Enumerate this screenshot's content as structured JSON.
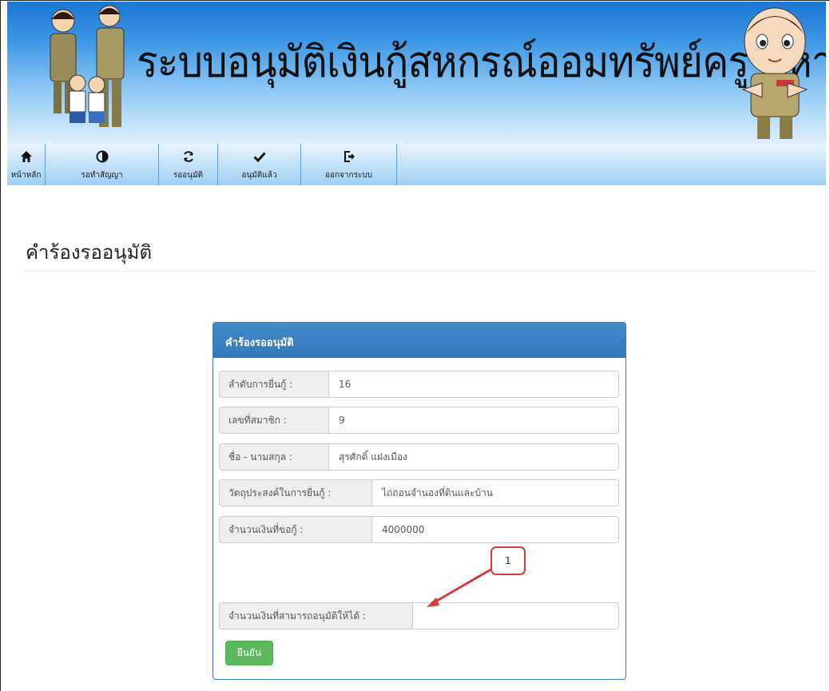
{
  "banner": {
    "title": "ระบบอนุมัติเงินกู้สหกรณ์ออมทรัพย์ครู มหาสารคาม"
  },
  "nav": {
    "items": [
      {
        "label": "หน้าหลัก",
        "icon": "home-icon"
      },
      {
        "label": "รอทำสัญญา",
        "icon": "half-circle-icon"
      },
      {
        "label": "รออนุมัติ",
        "icon": "refresh-icon"
      },
      {
        "label": "อนุมัติแล้ว",
        "icon": "checkmark-icon"
      },
      {
        "label": "ออกจากระบบ",
        "icon": "logout-icon"
      }
    ]
  },
  "page": {
    "title": "คำร้องรออนุมัติ"
  },
  "panel": {
    "heading": "คำร้องรออนุมัติ",
    "fields": [
      {
        "label": "ลำดับการยื่นกู้ :",
        "value": "16"
      },
      {
        "label": "เลขที่สมาชิก :",
        "value": "9"
      },
      {
        "label": "ชื่อ - นามสกุล :",
        "value": "สุรศักดิ์  แฝงเมือง"
      },
      {
        "label": "วัตถุประสงค์ในการยื่นกู้ :",
        "value": "ไถ่ถอนจำนองที่ดินและบ้าน"
      },
      {
        "label": "จำนวนเงินที่ขอกู้ :",
        "value": "4000000"
      }
    ],
    "approve_field": {
      "label": "จำนวนเงินที่สามารถอนุมัติให้ได้ :",
      "value": "",
      "placeholder": ""
    },
    "confirm_label": "ยืนยัน"
  },
  "annotation": {
    "number": "1",
    "color": "#d23c3c"
  },
  "colors": {
    "panel_header": "#428bca",
    "confirm_button": "#5cb85c",
    "nav_border": "#5aa3df"
  }
}
